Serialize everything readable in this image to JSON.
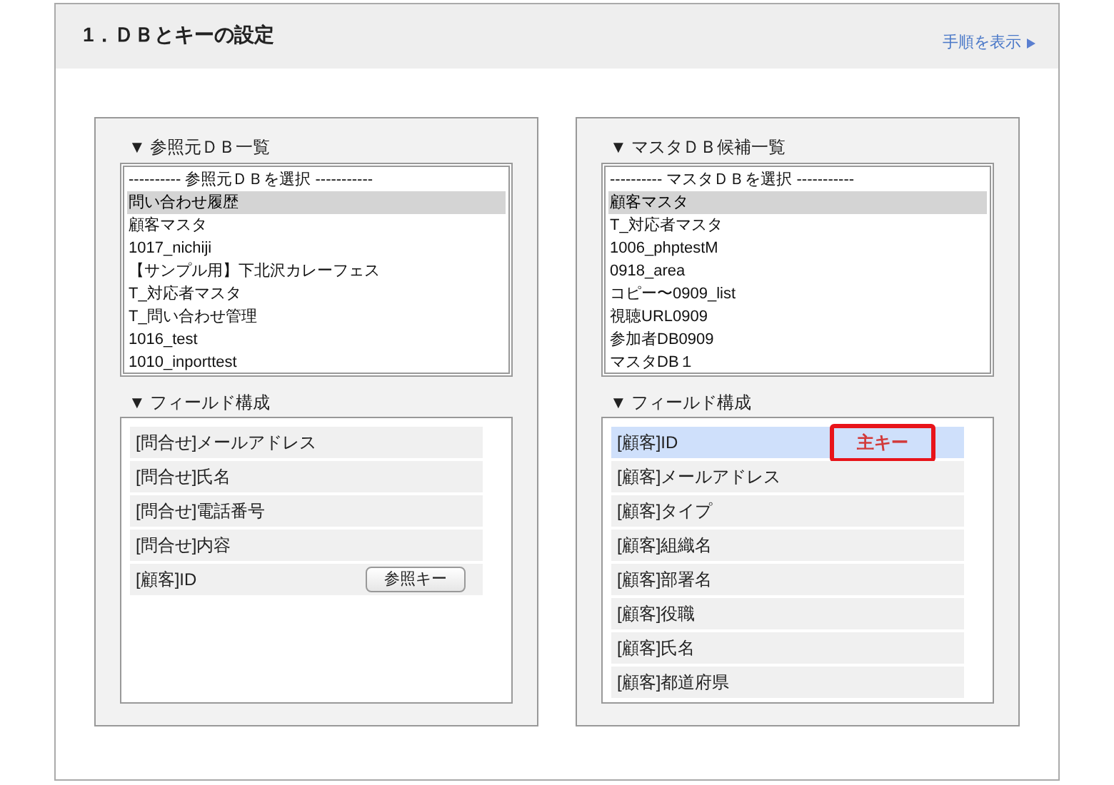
{
  "header": {
    "title": "1．ＤＢとキーの設定",
    "link": "手順を表示"
  },
  "panels": [
    {
      "list_heading": "▼ 参照元ＤＢ一覧",
      "list_items": [
        {
          "label": "---------- 参照元ＤＢを選択 -----------",
          "selected": false
        },
        {
          "label": "問い合わせ履歴",
          "selected": true
        },
        {
          "label": "顧客マスタ",
          "selected": false
        },
        {
          "label": "1017_nichiji",
          "selected": false
        },
        {
          "label": "【サンプル用】下北沢カレーフェス",
          "selected": false
        },
        {
          "label": "T_対応者マスタ",
          "selected": false
        },
        {
          "label": "T_問い合わせ管理",
          "selected": false
        },
        {
          "label": "1016_test",
          "selected": false
        },
        {
          "label": "1010_inporttest",
          "selected": false
        }
      ],
      "fields_heading": "▼ フィールド構成",
      "fields": [
        {
          "label": "[問合せ]メールアドレス",
          "selected": false
        },
        {
          "label": "[問合せ]氏名",
          "selected": false
        },
        {
          "label": "[問合せ]電話番号",
          "selected": false
        },
        {
          "label": "[問合せ]内容",
          "selected": false
        },
        {
          "label": "[顧客]ID",
          "selected": false,
          "action": {
            "kind": "button",
            "label": "参照キー"
          }
        }
      ]
    },
    {
      "list_heading": "▼ マスタＤＢ候補一覧",
      "list_items": [
        {
          "label": "---------- マスタＤＢを選択 -----------",
          "selected": false
        },
        {
          "label": "顧客マスタ",
          "selected": true
        },
        {
          "label": "T_対応者マスタ",
          "selected": false
        },
        {
          "label": "1006_phptestM",
          "selected": false
        },
        {
          "label": "0918_area",
          "selected": false
        },
        {
          "label": "コピー〜0909_list",
          "selected": false
        },
        {
          "label": "視聴URL0909",
          "selected": false
        },
        {
          "label": "参加者DB0909",
          "selected": false
        },
        {
          "label": "マスタDB１",
          "selected": false
        }
      ],
      "fields_heading": "▼ フィールド構成",
      "fields": [
        {
          "label": "[顧客]ID",
          "selected": true,
          "action": {
            "kind": "badge",
            "label": "主キー"
          }
        },
        {
          "label": "[顧客]メールアドレス",
          "selected": false
        },
        {
          "label": "[顧客]タイプ",
          "selected": false
        },
        {
          "label": "[顧客]組織名",
          "selected": false
        },
        {
          "label": "[顧客]部署名",
          "selected": false
        },
        {
          "label": "[顧客]役職",
          "selected": false
        },
        {
          "label": "[顧客]氏名",
          "selected": false
        },
        {
          "label": "[顧客]都道府県",
          "selected": false
        }
      ]
    }
  ]
}
